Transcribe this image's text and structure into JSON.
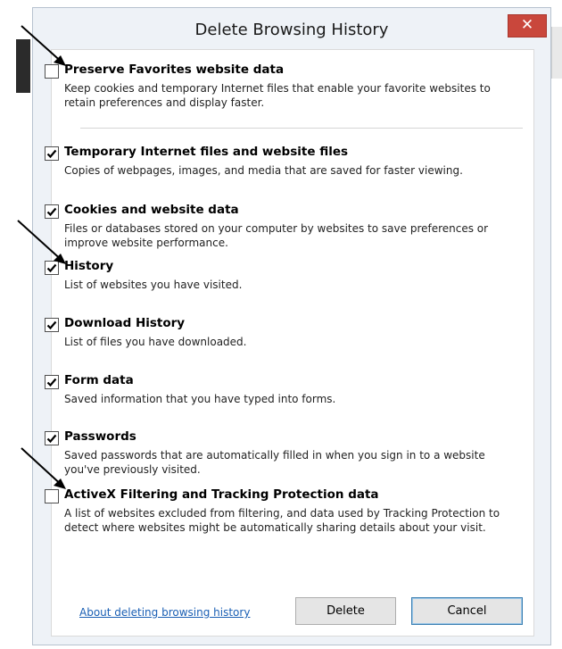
{
  "dialog": {
    "title": "Delete Browsing History",
    "close_label": "✕"
  },
  "options": [
    {
      "label": "Preserve Favorites website data",
      "description": "Keep cookies and temporary Internet files that enable your favorite websites to retain preferences and display faster.",
      "checked": false
    },
    {
      "label": "Temporary Internet files and website files",
      "description": "Copies of webpages, images, and media that are saved for faster viewing.",
      "checked": true
    },
    {
      "label": "Cookies and website data",
      "description": "Files or databases stored on your computer by websites to save preferences or improve website performance.",
      "checked": true
    },
    {
      "label": "History",
      "description": "List of websites you have visited.",
      "checked": true
    },
    {
      "label": "Download History",
      "description": "List of files you have downloaded.",
      "checked": true
    },
    {
      "label": "Form data",
      "description": "Saved information that you have typed into forms.",
      "checked": true
    },
    {
      "label": "Passwords",
      "description": "Saved passwords that are automatically filled in when you sign in to a website you've previously visited.",
      "checked": true
    },
    {
      "label": "ActiveX Filtering and Tracking Protection data",
      "description": "A list of websites excluded from filtering, and data used by Tracking Protection to detect where websites might be automatically sharing details about your visit.",
      "checked": false
    }
  ],
  "footer": {
    "link_label": "About deleting browsing history",
    "delete_label": "Delete",
    "cancel_label": "Cancel"
  },
  "colors": {
    "close_button": "#c9473c",
    "link": "#1a5fb4",
    "dialog_frame": "#eef2f7",
    "arrow": "#000000"
  },
  "icons": {
    "close": "close-icon",
    "check": "checkmark-icon",
    "annotation": "arrow-icon"
  }
}
